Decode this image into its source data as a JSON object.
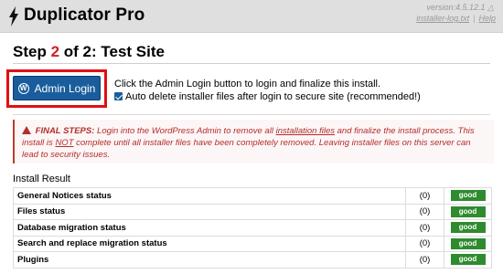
{
  "header": {
    "title": "Duplicator Pro",
    "version": "version:4.5.12.1",
    "log_link": "installer-log.txt",
    "help_link": "Help",
    "icon": "bolt-icon"
  },
  "step": {
    "prefix": "Step",
    "current": "2",
    "middle": "of 2: Test Site"
  },
  "login": {
    "button_label": "Admin Login",
    "instruction": "Click the Admin Login button to login and finalize this install.",
    "checkbox_label": "Auto delete installer files after login to secure site (recommended!)",
    "checkbox_checked": true
  },
  "warning": {
    "heading": "FINAL STEPS:",
    "text1": "Login into the WordPress Admin to remove all",
    "link": "installation files",
    "text2": "and finalize the install process. This install is",
    "not_word": "NOT",
    "text3": "complete until all installer files have been completely removed. Leaving installer files on this server can lead to security issues."
  },
  "install_result": {
    "label": "Install Result",
    "rows": [
      {
        "name": "General Notices status",
        "count": "(0)",
        "status": "good"
      },
      {
        "name": "Files status",
        "count": "(0)",
        "status": "good"
      },
      {
        "name": "Database migration status",
        "count": "(0)",
        "status": "good"
      },
      {
        "name": "Search and replace migration status",
        "count": "(0)",
        "status": "good"
      },
      {
        "name": "Plugins",
        "count": "(0)",
        "status": "good"
      }
    ]
  },
  "colors": {
    "accent_blue": "#1a5d9c",
    "step_red": "#cc2222",
    "highlight_red": "#e01010",
    "good_green": "#2e8b2e",
    "warning_red": "#b32d2e"
  }
}
